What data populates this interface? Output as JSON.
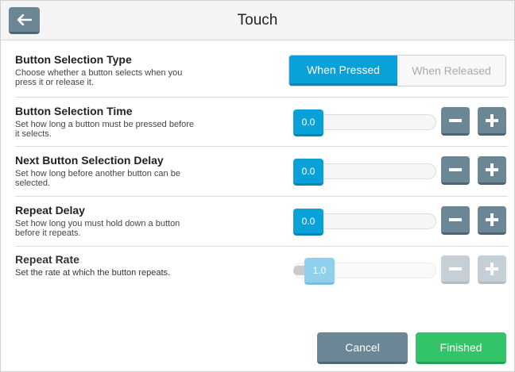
{
  "header": {
    "title": "Touch",
    "back_icon": "arrow-left-icon"
  },
  "settings": {
    "selection_type": {
      "title": "Button Selection Type",
      "desc": "Choose whether a button selects when you press it or release it.",
      "options": [
        "When Pressed",
        "When Released"
      ],
      "selected": "When Pressed"
    },
    "selection_time": {
      "title": "Button Selection Time",
      "desc": "Set how long a button must be pressed before it selects.",
      "value": "0.0"
    },
    "next_delay": {
      "title": "Next Button Selection Delay",
      "desc": "Set how long before another button can be selected.",
      "value": "0.0"
    },
    "repeat_delay": {
      "title": "Repeat Delay",
      "desc": "Set how long you must hold down a button before it repeats.",
      "value": "0.0"
    },
    "repeat_rate": {
      "title": "Repeat Rate",
      "desc": "Set the rate at which the button repeats.",
      "value": "1.0",
      "enabled": false
    }
  },
  "footer": {
    "cancel_label": "Cancel",
    "finish_label": "Finished"
  },
  "colors": {
    "accent": "#0aa0d8",
    "slate": "#6b8694",
    "success": "#33c46a"
  }
}
